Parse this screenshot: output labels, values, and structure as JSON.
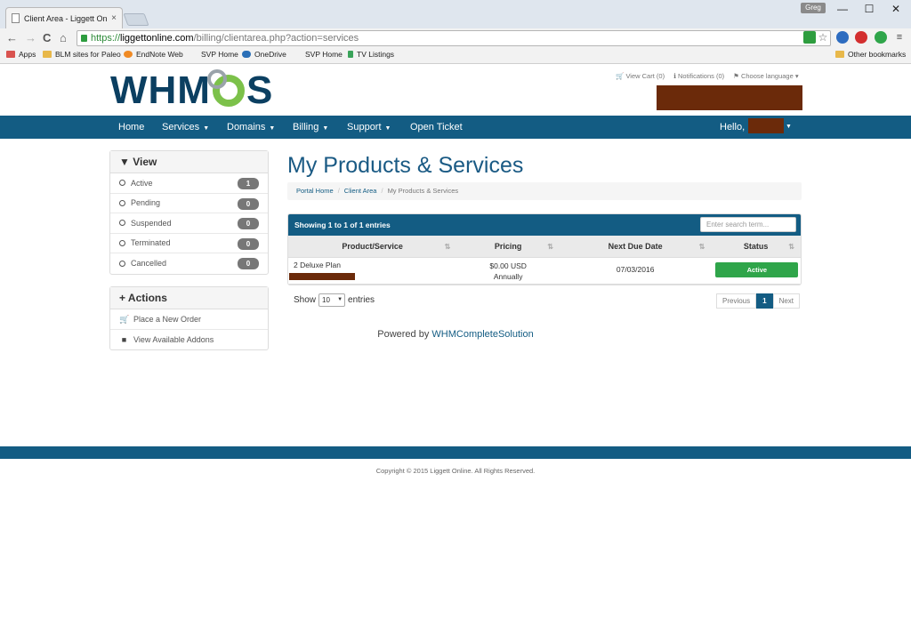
{
  "browser": {
    "tab_title": "Client Area - Liggett Onlin",
    "tab_close": "×",
    "user_badge": "Greg",
    "window_controls": {
      "minimize": "—",
      "maximize": "☐",
      "close": "✕"
    },
    "nav": {
      "back": "←",
      "forward": "→",
      "reload": "C",
      "home": "⌂"
    },
    "url": {
      "scheme": "https://",
      "host": "liggettonline.com",
      "path": "/billing/clientarea.php?action=services"
    },
    "bookmarks": [
      {
        "label": "Apps",
        "color": "#d9534f"
      },
      {
        "label": "BLM sites for Paleo",
        "color": "#e8b84a"
      },
      {
        "label": "EndNote Web",
        "color": "#f08a24"
      },
      {
        "label": "SVP Home",
        "color": ""
      },
      {
        "label": "OneDrive",
        "color": "#2a6fb7"
      },
      {
        "label": "SVP Home",
        "color": ""
      },
      {
        "label": "TV Listings",
        "color": "#3aa35a"
      }
    ],
    "other_bookmarks": "Other bookmarks"
  },
  "header": {
    "logo_text_left": "WHM",
    "logo_text_right": "S",
    "cart": "View Cart (0)",
    "notifications": "Notifications (0)",
    "language": "Choose language"
  },
  "navbar": {
    "items": [
      {
        "label": "Home",
        "dropdown": false
      },
      {
        "label": "Services",
        "dropdown": true
      },
      {
        "label": "Domains",
        "dropdown": true
      },
      {
        "label": "Billing",
        "dropdown": true
      },
      {
        "label": "Support",
        "dropdown": true
      },
      {
        "label": "Open Ticket",
        "dropdown": false
      }
    ],
    "hello": "Hello,"
  },
  "sidebar": {
    "view_title": "View",
    "view_items": [
      {
        "label": "Active",
        "count": "1"
      },
      {
        "label": "Pending",
        "count": "0"
      },
      {
        "label": "Suspended",
        "count": "0"
      },
      {
        "label": "Terminated",
        "count": "0"
      },
      {
        "label": "Cancelled",
        "count": "0"
      }
    ],
    "actions_title": "Actions",
    "action_items": [
      {
        "label": "Place a New Order",
        "icon": "cart-icon"
      },
      {
        "label": "View Available Addons",
        "icon": "cubes-icon"
      }
    ]
  },
  "main": {
    "title": "My Products & Services",
    "breadcrumb": [
      "Portal Home",
      "Client Area",
      "My Products & Services"
    ],
    "table": {
      "showing": "Showing 1 to 1 of 1 entries",
      "search_placeholder": "Enter search term...",
      "columns": [
        "Product/Service",
        "Pricing",
        "Next Due Date",
        "Status"
      ],
      "rows": [
        {
          "product": "2 Deluxe Plan",
          "price": "$0.00 USD",
          "cycle": "Annually",
          "due": "07/03/2016",
          "status": "Active"
        }
      ]
    },
    "show_label": "Show",
    "entries_value": "10",
    "entries_label": "entries",
    "pagination": {
      "previous": "Previous",
      "current": "1",
      "next": "Next"
    }
  },
  "footer": {
    "powered_prefix": "Powered by",
    "powered_link": "WHMCompleteSolution",
    "copyright": "Copyright © 2015 Liggett Online. All Rights Reserved."
  },
  "colors": {
    "brand": "#135c83",
    "active": "#2fa54a",
    "redaction": "#6b2a0a"
  }
}
